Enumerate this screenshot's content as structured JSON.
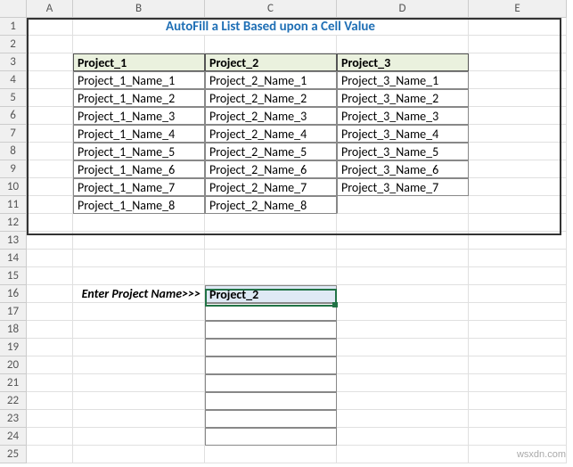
{
  "columns": [
    "A",
    "B",
    "C",
    "D",
    "E"
  ],
  "title": "AutoFill a List Based upon a Cell Value",
  "table": {
    "headers": [
      "Project_1",
      "Project_2",
      "Project_3"
    ],
    "rows": [
      [
        "Project_1_Name_1",
        "Project_2_Name_1",
        "Project_3_Name_1"
      ],
      [
        "Project_1_Name_2",
        "Project_2_Name_2",
        "Project_3_Name_2"
      ],
      [
        "Project_1_Name_3",
        "Project_2_Name_3",
        "Project_3_Name_3"
      ],
      [
        "Project_1_Name_4",
        "Project_2_Name_4",
        "Project_3_Name_4"
      ],
      [
        "Project_1_Name_5",
        "Project_2_Name_5",
        "Project_3_Name_5"
      ],
      [
        "Project_1_Name_6",
        "Project_2_Name_6",
        "Project_3_Name_6"
      ],
      [
        "Project_1_Name_7",
        "Project_2_Name_7",
        "Project_3_Name_7"
      ],
      [
        "Project_1_Name_8",
        "Project_2_Name_8",
        ""
      ]
    ]
  },
  "input": {
    "label": "Enter Project Name>>>",
    "value": "Project_2"
  },
  "watermark": "wsxdn.com"
}
